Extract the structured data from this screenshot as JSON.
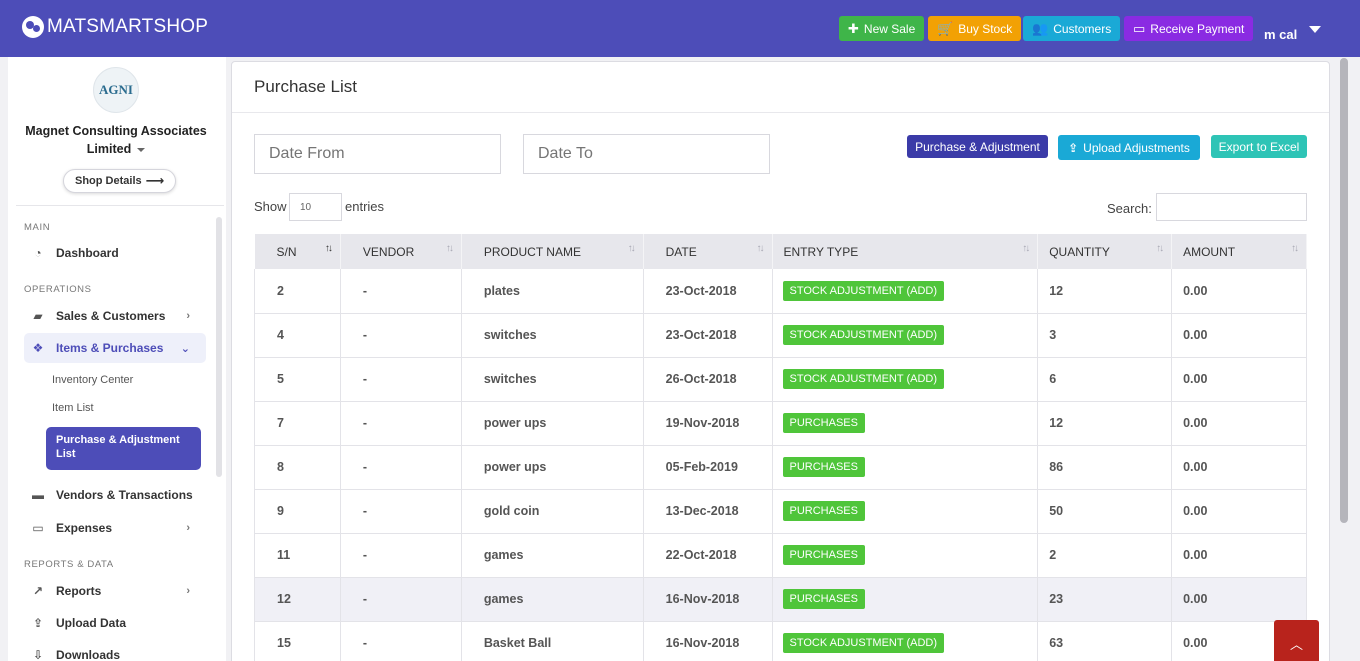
{
  "app": {
    "name": "MATSMARTSHOP"
  },
  "topbar": {
    "buttons": [
      {
        "label": "New Sale",
        "icon": "plus-icon",
        "color": "#3fb549"
      },
      {
        "label": "Buy Stock",
        "icon": "cart-icon",
        "color": "#f2a104"
      },
      {
        "label": "Customers",
        "icon": "users-icon",
        "color": "#1aa9d6"
      },
      {
        "label": "Receive Payment",
        "icon": "credit-card-icon",
        "color": "#8a2be2"
      }
    ],
    "user": "m cal"
  },
  "sidebar": {
    "avatar_text": "AGNI",
    "company": "Magnet Consulting Associates Limited",
    "shop_details": "Shop Details",
    "sections": {
      "main": "MAIN",
      "operations": "OPERATIONS",
      "reports": "REPORTS & DATA"
    },
    "items": {
      "dashboard": "Dashboard",
      "sales": "Sales & Customers",
      "items_purchases": "Items & Purchases",
      "inventory_center": "Inventory Center",
      "item_list": "Item List",
      "purchase_adjustment": "Purchase & Adjustment List",
      "vendors": "Vendors & Transactions",
      "expenses": "Expenses",
      "reports": "Reports",
      "upload_data": "Upload Data",
      "downloads": "Downloads"
    }
  },
  "main": {
    "title": "Purchase List",
    "date_from_placeholder": "Date From",
    "date_to_placeholder": "Date To",
    "buttons": {
      "purchase_adjustment": "Purchase & Adjustment",
      "upload_adjustments": "Upload Adjustments",
      "export_excel": "Export to Excel"
    },
    "show_label": "Show",
    "entries_value": "10",
    "entries_label": "entries",
    "search_label": "Search:",
    "table": {
      "columns": [
        "S/N",
        "VENDOR",
        "PRODUCT NAME",
        "DATE",
        "ENTRY TYPE",
        "QUANTITY",
        "AMOUNT"
      ],
      "rows": [
        {
          "sn": "2",
          "vendor": "-",
          "product": "plates",
          "date": "23-Oct-2018",
          "type": "STOCK ADJUSTMENT (ADD)",
          "qty": "12",
          "amount": "0.00"
        },
        {
          "sn": "4",
          "vendor": "-",
          "product": "switches",
          "date": "23-Oct-2018",
          "type": "STOCK ADJUSTMENT (ADD)",
          "qty": "3",
          "amount": "0.00"
        },
        {
          "sn": "5",
          "vendor": "-",
          "product": "switches",
          "date": "26-Oct-2018",
          "type": "STOCK ADJUSTMENT (ADD)",
          "qty": "6",
          "amount": "0.00"
        },
        {
          "sn": "7",
          "vendor": "-",
          "product": "power ups",
          "date": "19-Nov-2018",
          "type": "PURCHASES",
          "qty": "12",
          "amount": "0.00"
        },
        {
          "sn": "8",
          "vendor": "-",
          "product": "power ups",
          "date": "05-Feb-2019",
          "type": "PURCHASES",
          "qty": "86",
          "amount": "0.00"
        },
        {
          "sn": "9",
          "vendor": "-",
          "product": "gold coin",
          "date": "13-Dec-2018",
          "type": "PURCHASES",
          "qty": "50",
          "amount": "0.00"
        },
        {
          "sn": "11",
          "vendor": "-",
          "product": "games",
          "date": "22-Oct-2018",
          "type": "PURCHASES",
          "qty": "2",
          "amount": "0.00"
        },
        {
          "sn": "12",
          "vendor": "-",
          "product": "games",
          "date": "16-Nov-2018",
          "type": "PURCHASES",
          "qty": "23",
          "amount": "0.00"
        },
        {
          "sn": "15",
          "vendor": "-",
          "product": "Basket Ball",
          "date": "16-Nov-2018",
          "type": "STOCK ADJUSTMENT (ADD)",
          "qty": "63",
          "amount": "0.00"
        }
      ]
    }
  },
  "colors": {
    "primary": "#4d4db8",
    "badge_green": "#4fc53a",
    "back_to_top": "#b8231c"
  }
}
